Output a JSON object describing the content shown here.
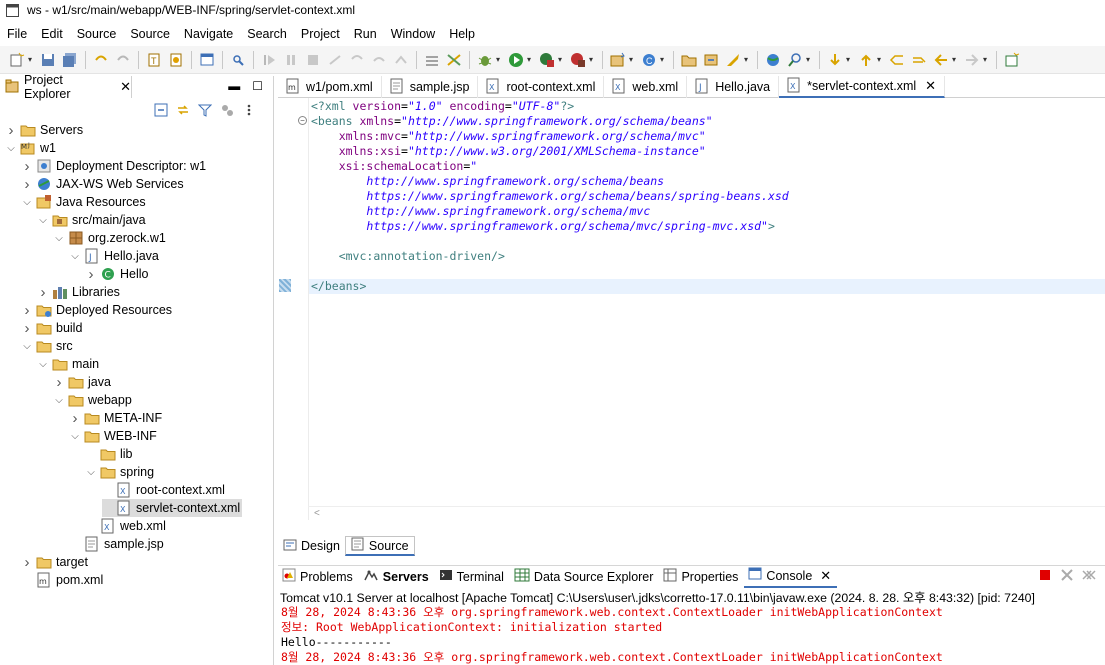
{
  "window": {
    "title": "ws - w1/src/main/webapp/WEB-INF/spring/servlet-context.xml"
  },
  "menu": [
    "File",
    "Edit",
    "Source",
    "Source",
    "Navigate",
    "Search",
    "Project",
    "Run",
    "Window",
    "Help"
  ],
  "explorer": {
    "title": "Project Explorer",
    "tree": [
      {
        "label": "Servers",
        "level": 0,
        "twisty": "closed",
        "icon": "folder-icon"
      },
      {
        "label": "w1",
        "level": 0,
        "twisty": "open",
        "icon": "maven-project-icon"
      },
      {
        "label": "Deployment Descriptor: w1",
        "level": 1,
        "twisty": "closed",
        "icon": "deployment-descriptor-icon"
      },
      {
        "label": "JAX-WS Web Services",
        "level": 1,
        "twisty": "closed",
        "icon": "web-services-icon"
      },
      {
        "label": "Java Resources",
        "level": 1,
        "twisty": "open",
        "icon": "java-resources-icon"
      },
      {
        "label": "src/main/java",
        "level": 2,
        "twisty": "open",
        "icon": "source-folder-icon"
      },
      {
        "label": "org.zerock.w1",
        "level": 3,
        "twisty": "open",
        "icon": "package-icon"
      },
      {
        "label": "Hello.java",
        "level": 4,
        "twisty": "open",
        "icon": "java-file-icon"
      },
      {
        "label": "Hello",
        "level": 5,
        "twisty": "closed",
        "icon": "class-icon"
      },
      {
        "label": "Libraries",
        "level": 2,
        "twisty": "closed",
        "icon": "libraries-icon"
      },
      {
        "label": "Deployed Resources",
        "level": 1,
        "twisty": "closed",
        "icon": "deployed-resources-icon"
      },
      {
        "label": "build",
        "level": 1,
        "twisty": "closed",
        "icon": "folder-icon"
      },
      {
        "label": "src",
        "level": 1,
        "twisty": "open",
        "icon": "folder-icon"
      },
      {
        "label": "main",
        "level": 2,
        "twisty": "open",
        "icon": "folder-icon"
      },
      {
        "label": "java",
        "level": 3,
        "twisty": "closed",
        "icon": "folder-icon"
      },
      {
        "label": "webapp",
        "level": 3,
        "twisty": "open",
        "icon": "folder-icon"
      },
      {
        "label": "META-INF",
        "level": 4,
        "twisty": "closed",
        "icon": "folder-icon"
      },
      {
        "label": "WEB-INF",
        "level": 4,
        "twisty": "open",
        "icon": "folder-icon"
      },
      {
        "label": "lib",
        "level": 5,
        "twisty": "none",
        "icon": "folder-icon"
      },
      {
        "label": "spring",
        "level": 5,
        "twisty": "open",
        "icon": "folder-icon"
      },
      {
        "label": "root-context.xml",
        "level": 6,
        "twisty": "none",
        "icon": "xml-file-icon"
      },
      {
        "label": "servlet-context.xml",
        "level": 6,
        "twisty": "none",
        "icon": "xml-file-icon",
        "selected": true
      },
      {
        "label": "web.xml",
        "level": 5,
        "twisty": "none",
        "icon": "xml-file-icon"
      },
      {
        "label": "sample.jsp",
        "level": 4,
        "twisty": "none",
        "icon": "jsp-file-icon"
      },
      {
        "label": "target",
        "level": 1,
        "twisty": "closed",
        "icon": "folder-icon"
      },
      {
        "label": "pom.xml",
        "level": 1,
        "twisty": "none",
        "icon": "pom-file-icon"
      }
    ]
  },
  "editor_tabs": [
    {
      "label": "w1/pom.xml",
      "icon": "pom-file-icon"
    },
    {
      "label": "sample.jsp",
      "icon": "jsp-file-icon"
    },
    {
      "label": "root-context.xml",
      "icon": "xml-file-icon"
    },
    {
      "label": "web.xml",
      "icon": "xml-file-icon"
    },
    {
      "label": "Hello.java",
      "icon": "java-file-icon"
    },
    {
      "label": "*servlet-context.xml",
      "icon": "xml-file-icon",
      "active": true
    }
  ],
  "code_lines": [
    [
      [
        "pi",
        "<?xml "
      ],
      [
        "attr",
        "version"
      ],
      [
        "plain",
        "="
      ],
      [
        "val",
        "\"1.0\""
      ],
      [
        "plain",
        " "
      ],
      [
        "attr",
        "encoding"
      ],
      [
        "plain",
        "="
      ],
      [
        "val",
        "\"UTF-8\""
      ],
      [
        "pi",
        "?>"
      ]
    ],
    [
      [
        "tag",
        "<beans "
      ],
      [
        "attr",
        "xmlns"
      ],
      [
        "plain",
        "="
      ],
      [
        "val",
        "\"http://www.springframework.org/schema/beans\""
      ]
    ],
    [
      [
        "plain",
        "    "
      ],
      [
        "attr",
        "xmlns:mvc"
      ],
      [
        "plain",
        "="
      ],
      [
        "val",
        "\"http://www.springframework.org/schema/mvc\""
      ]
    ],
    [
      [
        "plain",
        "    "
      ],
      [
        "attr",
        "xmlns:xsi"
      ],
      [
        "plain",
        "="
      ],
      [
        "val",
        "\"http://www.w3.org/2001/XMLSchema-instance\""
      ]
    ],
    [
      [
        "plain",
        "    "
      ],
      [
        "attr",
        "xsi:schemaLocation"
      ],
      [
        "plain",
        "="
      ],
      [
        "val",
        "\""
      ]
    ],
    [
      [
        "plain",
        "        "
      ],
      [
        "val",
        "http://www.springframework.org/schema/beans"
      ]
    ],
    [
      [
        "plain",
        "        "
      ],
      [
        "val",
        "https://www.springframework.org/schema/beans/spring-beans.xsd"
      ]
    ],
    [
      [
        "plain",
        "        "
      ],
      [
        "val",
        "http://www.springframework.org/schema/mvc"
      ]
    ],
    [
      [
        "plain",
        "        "
      ],
      [
        "val",
        "https://www.springframework.org/schema/mvc/spring-mvc.xsd\""
      ],
      [
        "tag",
        ">"
      ]
    ],
    [],
    [
      [
        "plain",
        "    "
      ],
      [
        "tag",
        "<mvc:annotation-driven/>"
      ]
    ],
    [],
    [
      [
        "tag",
        "</beans>"
      ]
    ]
  ],
  "design_source_tabs": [
    {
      "label": "Design",
      "icon": "design-icon"
    },
    {
      "label": "Source",
      "icon": "source-icon",
      "active": true
    }
  ],
  "panel_tabs": [
    {
      "label": "Problems",
      "icon": "problems-icon"
    },
    {
      "label": "Servers",
      "icon": "servers-icon",
      "bold": true
    },
    {
      "label": "Terminal",
      "icon": "terminal-icon"
    },
    {
      "label": "Data Source Explorer",
      "icon": "data-source-icon"
    },
    {
      "label": "Properties",
      "icon": "properties-icon"
    },
    {
      "label": "Console",
      "icon": "console-icon",
      "active": true
    }
  ],
  "console": {
    "header": "Tomcat v10.1 Server at localhost [Apache Tomcat] C:\\Users\\user\\.jdks\\corretto-17.0.11\\bin\\javaw.exe  (2024. 8. 28. 오후 8:43:32) [pid: 7240]",
    "lines": [
      {
        "text": "8월 28, 2024 8:43:36 오후 org.springframework.web.context.ContextLoader initWebApplicationContext",
        "color": "red"
      },
      {
        "text": "정보: Root WebApplicationContext: initialization started",
        "color": "red"
      },
      {
        "text": "Hello-----------",
        "color": "black"
      },
      {
        "text": "8월 28, 2024 8:43:36 오후 org.springframework.web.context.ContextLoader initWebApplicationContext",
        "color": "red"
      }
    ]
  },
  "colors": {
    "accent": "#3d6fb6",
    "console_error": "#e00000",
    "xml_tag": "#3f7f7f",
    "xml_attr": "#7f007f",
    "xml_value": "#2a00ff"
  }
}
